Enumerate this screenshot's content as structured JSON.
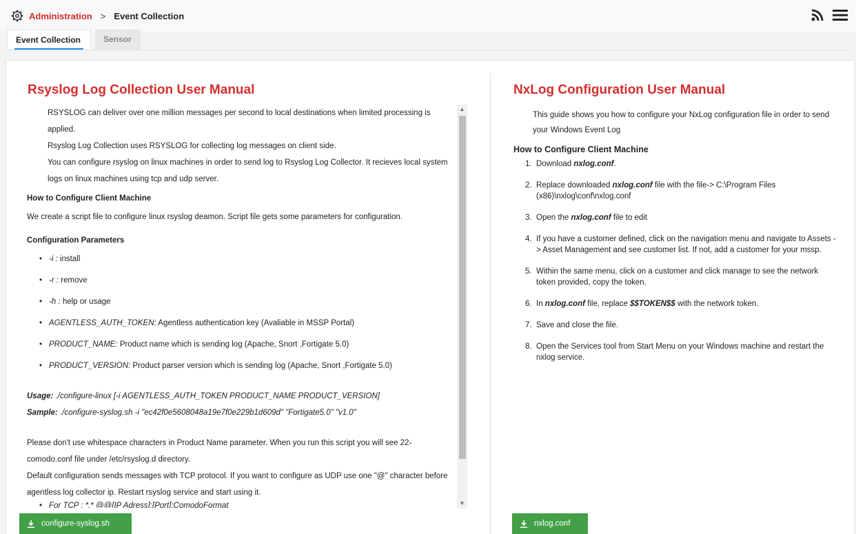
{
  "breadcrumb": {
    "root": "Administration",
    "separator": ">",
    "current": "Event Collection"
  },
  "tabs": [
    {
      "label": "Event Collection",
      "active": true
    },
    {
      "label": "Sensor",
      "active": false
    }
  ],
  "left": {
    "title": "Rsyslog Log Collection User Manual",
    "intro": [
      "RSYSLOG can deliver over one million messages per second to local destinations when limited processing is applied.",
      "Rsyslog Log Collection uses RSYSLOG for collecting log messages on client side.",
      "You can configure rsyslog on linux machines in order to send log to Rsyslog Log Collector. It recieves local system logs on linux machines using tcp and udp server."
    ],
    "how_heading": "How to Configure Client Machine",
    "how_text": "We create a script file to configure linux rsyslog deamon. Script file gets some parameters for configuration.",
    "params_heading": "Configuration Parameters",
    "params": [
      {
        "key": "-i :",
        "desc": "install"
      },
      {
        "key": "-r :",
        "desc": "remove"
      },
      {
        "key": "-h :",
        "desc": "help or usage"
      },
      {
        "key": "AGENTLESS_AUTH_TOKEN:",
        "desc": "Agentless authentication key (Avaliable in MSSP Portal)"
      },
      {
        "key": "PRODUCT_NAME:",
        "desc": "Product name which is sending log (Apache, Snort ,Fortigate 5.0)"
      },
      {
        "key": "PRODUCT_VERSION:",
        "desc": "Product parser version which is sending log (Apache, Snort ,Fortigate 5.0)"
      }
    ],
    "usage_label": "Usage:",
    "usage_text": "./configure-linux [-i AGENTLESS_AUTH_TOKEN PRODUCT_NAME PRODUCT_VERSION]",
    "sample_label": "Sample:",
    "sample_text": "./configure-syslog.sh -i \"ec42f0e5608048a19e7f0e229b1d609d\" \"Fortigate5.0\" \"v1.0\"",
    "note1": "Please don't use whitespace characters in Product Name parameter. When you run this script you will see 22-comodo.conf file under /etc/rsyslog.d directory.",
    "note2": "Default configuration sends messages with TCP protocol. If you want to configure as UDP use one \"@\" character before agentless log collector ip. Restart rsyslog service and start using it.",
    "tcp_item": "For TCP : *.* @@[IP Adress]:[Port]:ComodoFormat",
    "download_button": "configure-syslog.sh"
  },
  "right": {
    "title": "NxLog Configuration User Manual",
    "intro": "This guide shows you how to configure your NxLog configuration file in order to send your Windows Event Log",
    "how_heading": "How to Configure Client Machine",
    "steps": [
      {
        "num": "1.",
        "pre": "Download ",
        "strong": "nxlog.conf",
        "post": "."
      },
      {
        "num": "2.",
        "pre": "Replace downloaded ",
        "strong": "nxlog.conf",
        "post": " file with the file-> C:\\Program Files (x86)\\nxlog\\conf\\nxlog.conf"
      },
      {
        "num": "3.",
        "pre": "Open the ",
        "strong": "nxlog.conf",
        "post": " file to edit"
      },
      {
        "num": "4.",
        "pre": "If you have a customer defined, click on the navigation menu and navigate to Assets -> Asset Management and see customer list. If not, add a customer for your mssp.",
        "strong": "",
        "post": ""
      },
      {
        "num": "5.",
        "pre": "Within the same menu, click on a customer and click manage to see the network token provided, copy the token.",
        "strong": "",
        "post": ""
      },
      {
        "num": "6.",
        "pre": "In ",
        "strong": "nxlog.conf",
        "post": " file, replace ",
        "strong2": "$$TOKEN$$",
        "post2": " with the network token."
      },
      {
        "num": "7.",
        "pre": "Save and close the file.",
        "strong": "",
        "post": ""
      },
      {
        "num": "8.",
        "pre": "Open the Services tool from Start Menu on your Windows machine and restart the nxlog service.",
        "strong": "",
        "post": ""
      }
    ],
    "download_button": "nxlog.conf"
  },
  "colors": {
    "accent": "#d32f2f",
    "button": "#43a047",
    "tab_underline": "#1e88e5"
  },
  "icons": {
    "breadcrumb": "gear-icon",
    "rss": "rss-icon",
    "menu": "hamburger-menu-icon",
    "download": "download-icon"
  }
}
